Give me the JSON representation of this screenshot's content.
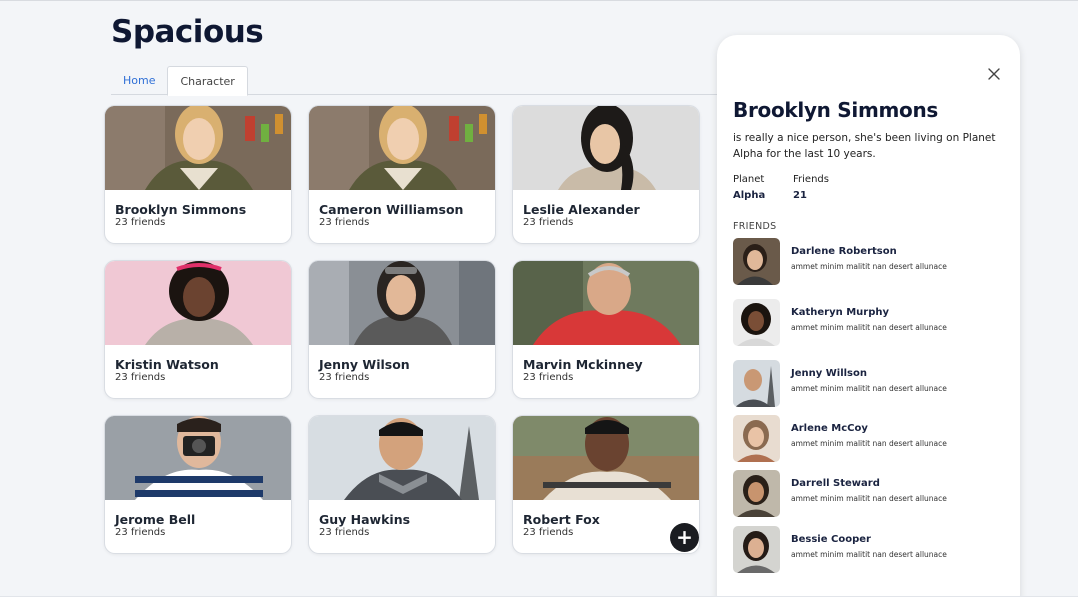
{
  "app": {
    "brand": "Spacious"
  },
  "tabs": [
    {
      "label": "Home",
      "active": false
    },
    {
      "label": "Character",
      "active": true
    }
  ],
  "characters": [
    {
      "name": "Brooklyn Simmons",
      "friends": "23 friends"
    },
    {
      "name": "Cameron Williamson",
      "friends": "23 friends"
    },
    {
      "name": "Leslie Alexander",
      "friends": "23 friends"
    },
    {
      "name": "Kristin Watson",
      "friends": "23 friends"
    },
    {
      "name": "Jenny Wilson",
      "friends": "23 friends"
    },
    {
      "name": "Marvin Mckinney",
      "friends": "23 friends"
    },
    {
      "name": "Jerome Bell",
      "friends": "23 friends"
    },
    {
      "name": "Guy Hawkins",
      "friends": "23 friends"
    },
    {
      "name": "Robert Fox",
      "friends": "23 friends"
    }
  ],
  "add_button": {
    "label": "+"
  },
  "detail": {
    "name": "Brooklyn Simmons",
    "bio": "is really a nice person, she's been living on Planet Alpha for the last 10 years.",
    "planet_label": "Planet",
    "planet_value": "Alpha",
    "friends_label": "Friends",
    "friends_value": "21",
    "friends_heading": "FRIENDS",
    "friends": [
      {
        "name": "Darlene Robertson",
        "desc": "ammet minim malitit nan desert allunace"
      },
      {
        "name": "Katheryn Murphy",
        "desc": "ammet minim malitit nan desert allunace"
      },
      {
        "name": "Jenny Willson",
        "desc": "ammet minim malitit nan desert allunace"
      },
      {
        "name": "Arlene McCoy",
        "desc": "ammet minim malitit nan desert allunace"
      },
      {
        "name": "Darrell Steward",
        "desc": "ammet minim malitit nan desert allunace"
      },
      {
        "name": "Bessie Cooper",
        "desc": "ammet minim malitit nan desert allunace"
      }
    ]
  },
  "colors": {
    "brand": "#0f1833",
    "link": "#2f6fd6",
    "background": "#f3f5f8",
    "fab": "#1a1c21"
  }
}
